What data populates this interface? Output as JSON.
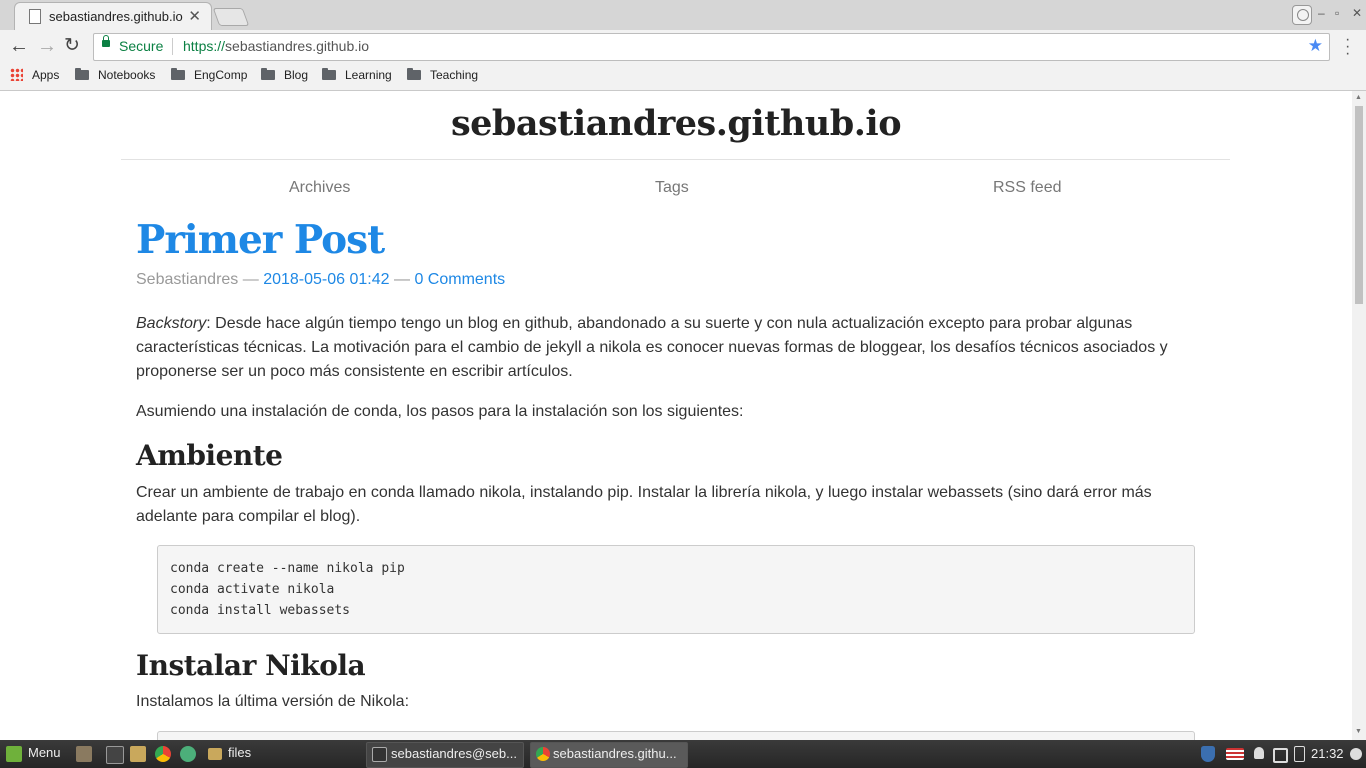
{
  "browser": {
    "tab_title": "sebastiandres.github.io",
    "secure_label": "Secure",
    "url_scheme": "https://",
    "url_host": "sebastiandres.github.io",
    "bookmarks": [
      "Apps",
      "Notebooks",
      "EngComp",
      "Blog",
      "Learning",
      "Teaching"
    ]
  },
  "site": {
    "title": "sebastiandres.github.io",
    "nav": [
      "Archives",
      "Tags",
      "RSS feed"
    ]
  },
  "post": {
    "title": "Primer Post",
    "author": "Sebastiandres",
    "dash": "—",
    "date": "2018-05-06 01:42",
    "comments": "0 Comments",
    "backstory_label": "Backstory",
    "p1": ": Desde hace algún tiempo tengo un blog en github, abandonado a su suerte y con nula actualización excepto para probar algunas características técnicas. La motivación para el cambio de jekyll a nikola es conocer nuevas formas de bloggear, los desafíos técnicos asociados y proponerse ser un poco más consistente en escribir artículos.",
    "p2": "Asumiendo una instalación de conda, los pasos para la instalación son los siguientes:",
    "h_ambiente": "Ambiente",
    "p3": "Crear un ambiente de trabajo en conda llamado nikola, instalando pip. Instalar la librería nikola, y luego instalar webassets (sino dará error más adelante para compilar el blog).",
    "code1": "conda create --name nikola pip\nconda activate nikola\nconda install webassets",
    "h_instalar": "Instalar Nikola",
    "p4": "Instalamos la última versión de Nikola:"
  },
  "taskbar": {
    "menu_label": "Menu",
    "files_label": "files",
    "terminal_label": "sebastiandres@seb...",
    "chrome_label": "sebastiandres.githu...",
    "clock": "21:32"
  },
  "colors": {
    "link": "#1e88e5",
    "secure": "#0b8043"
  }
}
